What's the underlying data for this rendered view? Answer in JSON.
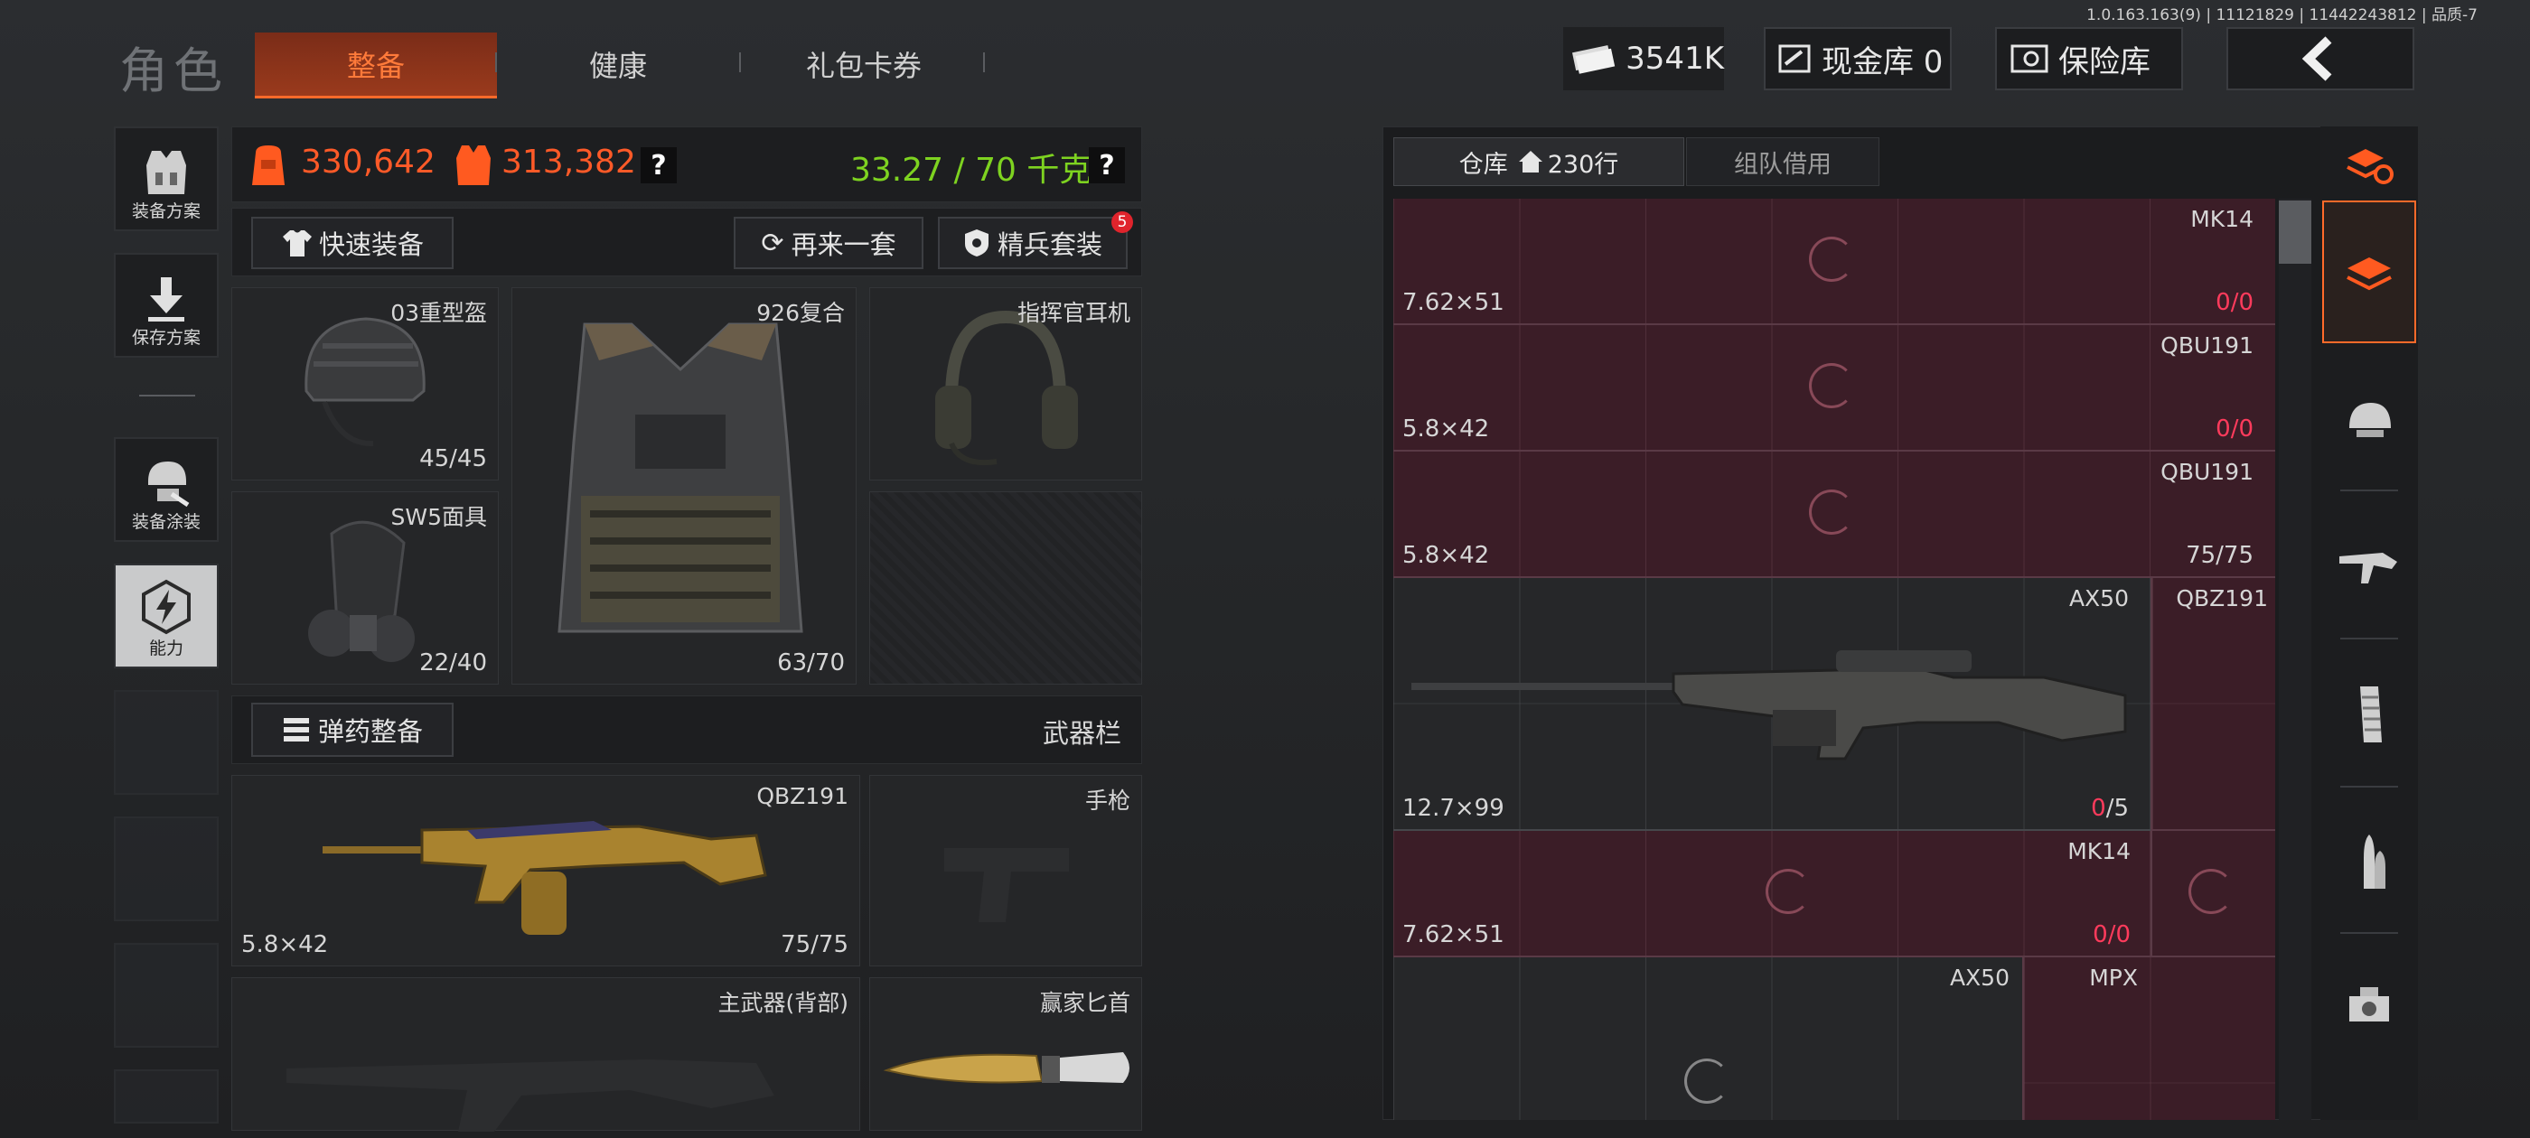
{
  "build_info": "1.0.163.163(9) | 11121829 | 11442243812 | 品质-7",
  "header": {
    "title": "角色",
    "tabs": [
      {
        "label": "整备",
        "active": true
      },
      {
        "label": "健康",
        "active": false
      },
      {
        "label": "礼包卡券",
        "active": false
      }
    ],
    "currency": "3541K",
    "cash_vault": "现金库 0",
    "safe_box": "保险库"
  },
  "sidebar": {
    "items": [
      {
        "label": "装备方案",
        "icon": "vest-icon"
      },
      {
        "label": "保存方案",
        "icon": "download-icon"
      },
      {
        "label": "装备涂装",
        "icon": "helmet-paint-icon"
      },
      {
        "label": "能力",
        "icon": "lightning-icon"
      }
    ]
  },
  "stats": {
    "value1": "330,642",
    "value2": "313,382",
    "weight": "33.27 / 70 千克",
    "help": "?"
  },
  "actions": {
    "quick_equip": "快速装备",
    "again": "再来一套",
    "elite_suit": "精兵套装",
    "elite_badge": "5"
  },
  "gear": {
    "helmet": {
      "name": "03重型盔",
      "durability": "45/45"
    },
    "armor": {
      "name": "926复合",
      "durability": "63/70"
    },
    "headset": {
      "name": "指挥官耳机"
    },
    "mask": {
      "name": "SW5面具",
      "durability": "22/40"
    }
  },
  "ammo_equip": "弹药整备",
  "weapon_bar": "武器栏",
  "primary": {
    "name": "QBZ191",
    "caliber": "5.8×42",
    "ammo": "75/75"
  },
  "pistol": {
    "label": "手枪"
  },
  "back_weapon": {
    "label": "主武器(背部)"
  },
  "knife": {
    "label": "赢家匕首"
  },
  "warehouse": {
    "tab_storage": "仓库",
    "rows_count": "230行",
    "tab_team": "组队借用",
    "rows": [
      {
        "name": "MK14",
        "caliber": "7.62×51",
        "ammo_cur": "0",
        "ammo_max": "/0"
      },
      {
        "name": "QBU191",
        "caliber": "5.8×42",
        "ammo_cur": "0",
        "ammo_max": "/0"
      },
      {
        "name": "QBU191",
        "caliber": "5.8×42",
        "ammo": "75/75"
      },
      {
        "name": "AX50",
        "caliber": "12.7×99",
        "ammo_cur": "0",
        "ammo_max": "/5",
        "side": "QBZ191"
      },
      {
        "name": "MK14",
        "caliber": "7.62×51",
        "ammo_cur": "0",
        "ammo_max": "/0"
      },
      {
        "name": "AX50",
        "side": "MPX"
      }
    ]
  },
  "colors": {
    "accent": "#ff6a2a",
    "red": "#ff3b5c",
    "green": "#7ed320",
    "warehouse_row": "#3b1d27"
  }
}
